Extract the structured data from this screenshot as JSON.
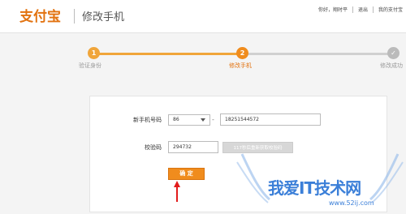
{
  "header": {
    "logo": "支付宝",
    "page_title": "修改手机",
    "nav": [
      "你好，翔时平",
      "退出",
      "我的支付宝"
    ]
  },
  "steps": [
    {
      "number": "1",
      "label": "验证身份",
      "state": "done"
    },
    {
      "number": "2",
      "label": "修改手机",
      "state": "current"
    },
    {
      "number": "✓",
      "label": "修改成功",
      "state": "pending"
    }
  ],
  "form": {
    "phone_label": "新手机号码",
    "country_code": "86",
    "dash": "-",
    "phone_value": "18251544572",
    "code_label": "校验码",
    "code_value": "294732",
    "sms_button": "117秒后重新获取校验码",
    "confirm_button": "确 定"
  },
  "watermark": {
    "main": "我爱IT技术网",
    "sub": "www.52ij.com"
  },
  "colors": {
    "brand_orange": "#f08c1d",
    "logo_orange": "#e2720f",
    "step_done": "#f0a53a",
    "step_pending": "#bbbbbb",
    "arrow_red": "#e21c1c",
    "watermark_blue": "#3b7fd8"
  }
}
